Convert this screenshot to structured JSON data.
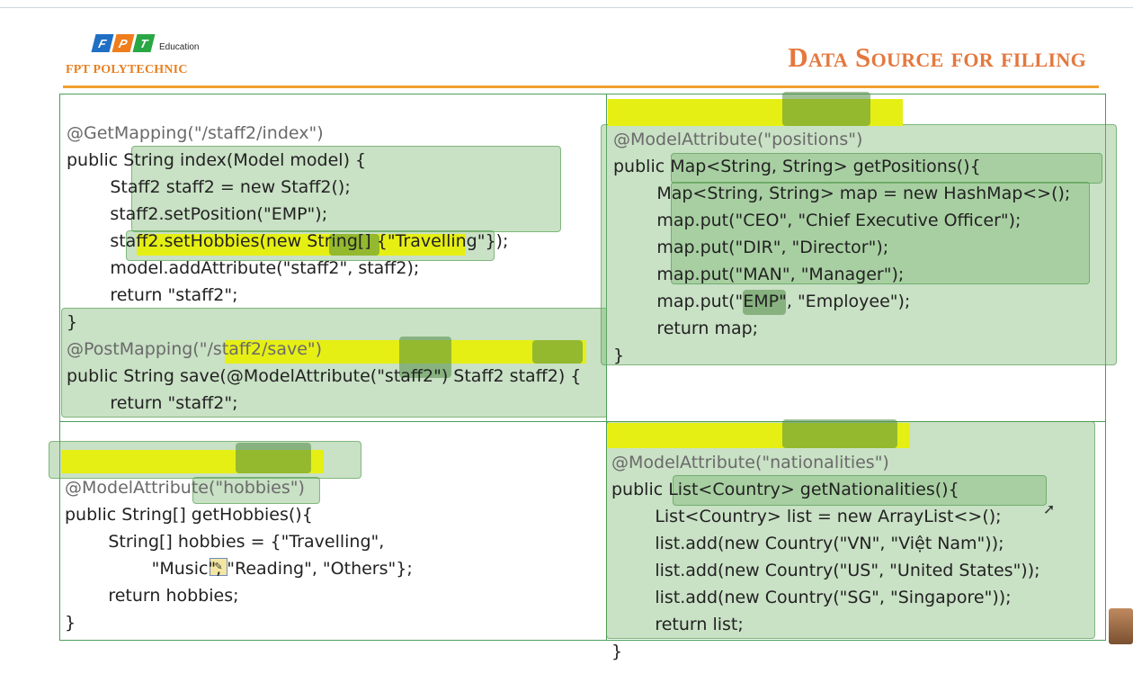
{
  "header": {
    "logo_letters": [
      "F",
      "P",
      "T"
    ],
    "logo_colors": [
      "#1f6fc4",
      "#ef7d1c",
      "#2aa745"
    ],
    "logo_edu": "Education",
    "brand": "FPT POLYTECHNIC",
    "title": "Data Source for filling"
  },
  "panels": {
    "top_left": {
      "lines": [
        "@GetMapping(\"/staff2/index\")",
        "public String index(Model model) {",
        "        Staff2 staff2 = new Staff2();",
        "        staff2.setPosition(\"EMP\");",
        "        staff2.setHobbies(new String[] {\"Travelling\"});",
        "        model.addAttribute(\"staff2\", staff2);",
        "        return \"staff2\";",
        "}",
        "@PostMapping(\"/staff2/save\")",
        "public String save(@ModelAttribute(\"staff2\") Staff2 staff2) {",
        "        return \"staff2\";",
        "}"
      ]
    },
    "top_right": {
      "lines": [
        "@ModelAttribute(\"positions\")",
        "public Map<String, String> getPositions(){",
        "        Map<String, String> map = new HashMap<>();",
        "        map.put(\"CEO\", \"Chief Executive Officer\");",
        "        map.put(\"DIR\", \"Director\");",
        "        map.put(\"MAN\", \"Manager\");",
        "        map.put(\"EMP\", \"Employee\");",
        "        return map;",
        "}"
      ]
    },
    "bottom_left": {
      "lines": [
        "@ModelAttribute(\"hobbies\")",
        "public String[] getHobbies(){",
        "        String[] hobbies = {\"Travelling\",",
        "                \"Music\", \"Reading\", \"Others\"};",
        "        return hobbies;",
        "}"
      ]
    },
    "bottom_right": {
      "lines": [
        "@ModelAttribute(\"nationalities\")",
        "public List<Country> getNationalities(){",
        "        List<Country> list = new ArrayList<>();",
        "        list.add(new Country(\"VN\", \"Việt Nam\"));",
        "        list.add(new Country(\"US\", \"United States\"));",
        "        list.add(new Country(\"SG\", \"Singapore\"));",
        "        return list;",
        "}"
      ]
    }
  }
}
